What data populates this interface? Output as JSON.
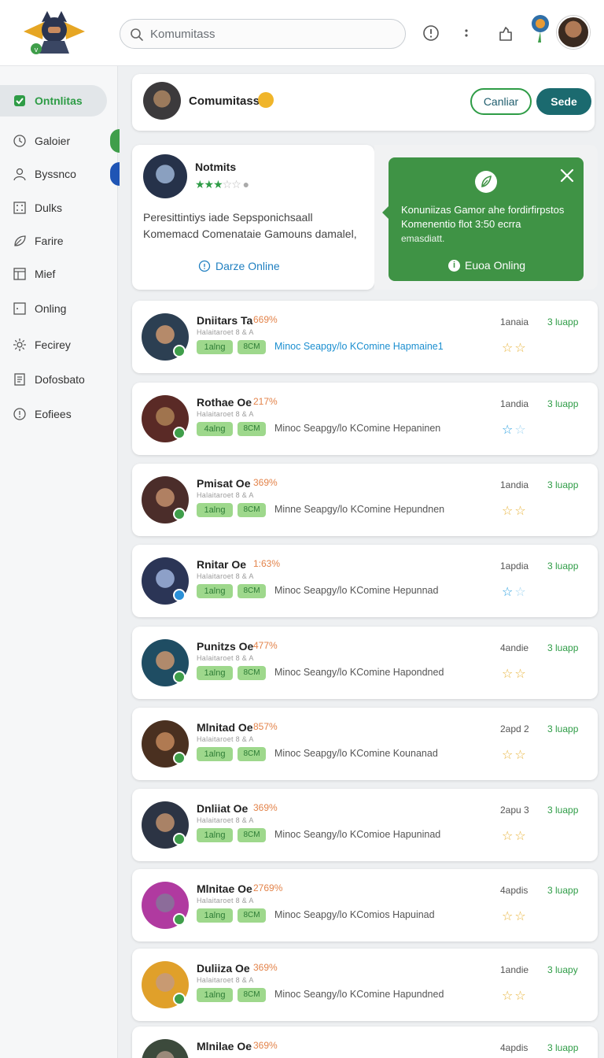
{
  "header": {
    "search_placeholder": "Komumitass"
  },
  "sidebar": {
    "items": [
      {
        "label": "Ontnlitas",
        "icon": "check-icon",
        "active": true
      },
      {
        "label": "Galoier",
        "icon": "history-icon"
      },
      {
        "label": "Byssnco",
        "icon": "user-icon"
      },
      {
        "label": "Dulks",
        "icon": "grid-icon"
      },
      {
        "label": "Farire",
        "icon": "leaf-icon"
      },
      {
        "label": "Mief",
        "icon": "table-icon"
      },
      {
        "label": "Onling",
        "icon": "square-icon"
      },
      {
        "label": "Fecirey",
        "icon": "gear-icon"
      },
      {
        "label": "Dofosbato",
        "icon": "document-icon"
      },
      {
        "label": "Eofiees",
        "icon": "info-icon"
      }
    ]
  },
  "community": {
    "title": "Comumitass",
    "cancel_label": "Canliar",
    "send_label": "Sede"
  },
  "profile": {
    "name": "Notmits",
    "rating": 3,
    "description": "Peresittintiys iade Sepsponichsaall Komemacd Comenataie Gamouns damalel,",
    "link_label": "Darze Online"
  },
  "toast": {
    "text": "Konuniizas Gamor ahe fordirfirpstos Komenentio flot 3:50 ecrra",
    "sub": "emasdiatt.",
    "link_label": "Euoa Onling"
  },
  "rows": [
    {
      "name": "Dniitars Ta",
      "pct": "669%",
      "sub": "Halaitaroet 8 & A",
      "tag1": "1alng",
      "tag2": "8CM",
      "desc": "Minoc Seapgy/lo KComine Hapmaine1",
      "desc_blue": true,
      "meta": "1anaia",
      "loop": "3 luapp",
      "stars": 2,
      "stars_blue": false
    },
    {
      "name": "Rothae Oe",
      "pct": "217%",
      "sub": "Halaitaroet 8 & A",
      "tag1": "4alng",
      "tag2": "8CM",
      "desc": "Minoc Seapgy/lo KComine Hepaninen",
      "desc_blue": false,
      "meta": "1andia",
      "loop": "3 luapp",
      "stars": 1,
      "stars_blue": true
    },
    {
      "name": "Pmisat Oe",
      "pct": "369%",
      "sub": "Halaitaroet 8 & A",
      "tag1": "1alng",
      "tag2": "8CM",
      "desc": "Minne Seapgy/lo KComine Hepundnen",
      "desc_blue": false,
      "meta": "1andia",
      "loop": "3 luapp",
      "stars": 2,
      "stars_blue": false
    },
    {
      "name": "Rnitar Oe",
      "pct": "1:63%",
      "sub": "Halaitaroet 8 & A",
      "tag1": "1alng",
      "tag2": "8CM",
      "desc": "Minoc Seapgy/lo KComine Hepunnad",
      "desc_blue": false,
      "meta": "1apdia",
      "loop": "3 luapp",
      "stars": 1,
      "stars_blue": true
    },
    {
      "name": "Punitzs Oe",
      "pct": "477%",
      "sub": "Halaitaroet 8 & A",
      "tag1": "1alng",
      "tag2": "8CM",
      "desc": "Minoc Seangy/lo KComine Hapondned",
      "desc_blue": false,
      "meta": "4andie",
      "loop": "3 luapp",
      "stars": 2,
      "stars_blue": false
    },
    {
      "name": "Mlnitad Oe",
      "pct": "857%",
      "sub": "Halaitaroet 8 & A",
      "tag1": "1alng",
      "tag2": "8CM",
      "desc": "Minoc Seapgy/lo KComine Kounanad",
      "desc_blue": false,
      "meta": "2apd 2",
      "loop": "3 luapp",
      "stars": 2,
      "stars_blue": false
    },
    {
      "name": "Dnliiat Oe",
      "pct": "369%",
      "sub": "Halaitaroet 8 & A",
      "tag1": "1alng",
      "tag2": "8CM",
      "desc": "Minoc Seangy/lo KComioe Hapuninad",
      "desc_blue": false,
      "meta": "2apu 3",
      "loop": "3 luapp",
      "stars": 2,
      "stars_blue": false
    },
    {
      "name": "Mlnitae Oe",
      "pct": "2769%",
      "sub": "Halaitaroet 8 & A",
      "tag1": "1alng",
      "tag2": "8CM",
      "desc": "Minoc Seapgy/lo KComios Hapuinad",
      "desc_blue": false,
      "meta": "4apdis",
      "loop": "3 luapp",
      "stars": 2,
      "stars_blue": false
    },
    {
      "name": "Duliiza Oe",
      "pct": "369%",
      "sub": "Halaitaroet 8 & A",
      "tag1": "1alng",
      "tag2": "8CM",
      "desc": "Minoc Seangy/lo KComine Hapundned",
      "desc_blue": false,
      "meta": "1andie",
      "loop": "3 luapy",
      "stars": 2,
      "stars_blue": false
    },
    {
      "name": "Mlnilae Oe",
      "pct": "369%",
      "sub": "",
      "tag1": "",
      "tag2": "",
      "desc": "",
      "desc_blue": false,
      "meta": "4apdis",
      "loop": "3 luapp",
      "stars": 0,
      "stars_blue": false
    }
  ],
  "colors": {
    "accent_green": "#2e9c46",
    "toast_green": "#3f9345",
    "send_button": "#1b6a6f",
    "link_blue": "#1f7fc0",
    "pct_orange": "#e3834a"
  }
}
